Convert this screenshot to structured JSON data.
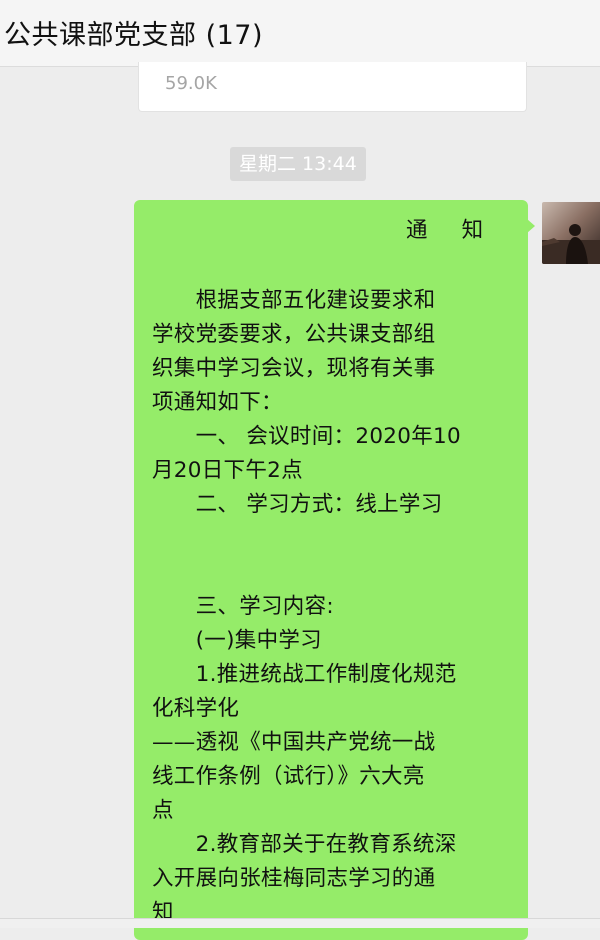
{
  "header": {
    "title": "公共课部党支部 (17)"
  },
  "file_card": {
    "size": "59.0K"
  },
  "timestamp": "星期二 13:44",
  "message": {
    "title": "通     知",
    "lines": [
      "　　根据支部五化建设要求和",
      "学校党委要求，公共课支部组",
      "织集中学习会议，现将有关事",
      "项通知如下：",
      "　　一、 会议时间：2020年10",
      "月20日下午2点",
      "　　二、 学习方式：线上学习",
      "",
      "",
      "　　三、学习内容:",
      "　　(一)集中学习",
      "　　1.推进统战工作制度化规范",
      "化科学化",
      "——透视《中国共产党统一战",
      "线工作条例（试行）》六大亮",
      "点",
      "　　2.教育部关于在教育系统深",
      "入开展向张桂梅同志学习的通",
      "知"
    ]
  },
  "colors": {
    "bubble": "#95ec69",
    "background": "#ededed",
    "header": "#f5f5f5"
  }
}
